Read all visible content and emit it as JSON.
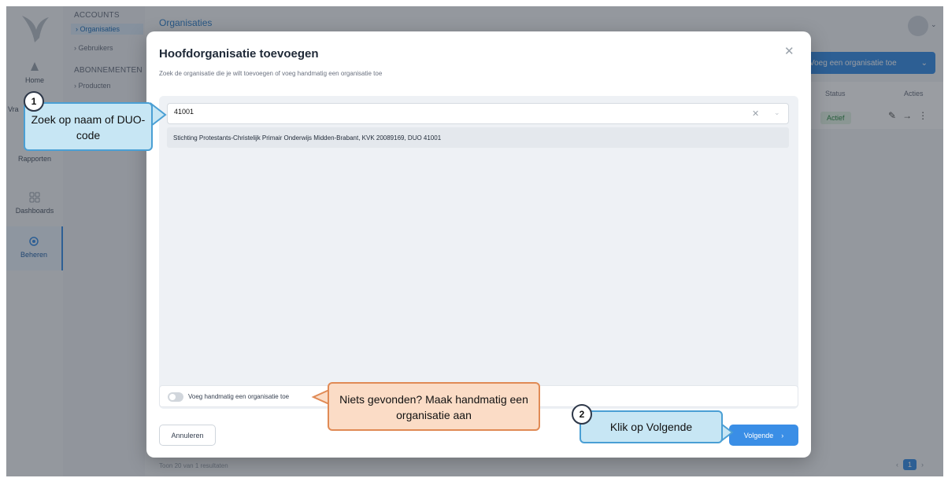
{
  "sidebar": {
    "items": [
      {
        "label": "Home",
        "icon": "home-icon"
      },
      {
        "label": "Vra",
        "icon": "question-icon"
      },
      {
        "label": "Rapporten",
        "icon": "report-icon"
      },
      {
        "label": "Dashboards",
        "icon": "dashboard-icon"
      },
      {
        "label": "Beheren",
        "icon": "gear-icon",
        "active": true
      }
    ]
  },
  "subnav": {
    "accounts_heading": "ACCOUNTS",
    "organisaties": "Organisaties",
    "gebruikers": "Gebruikers",
    "abonnementen_heading": "ABONNEMENTEN",
    "producten": "Producten"
  },
  "page": {
    "title": "Organisaties",
    "add_button": "Voeg een organisatie toe",
    "columns": [
      "Status",
      "Acties"
    ],
    "status_value": "Actief",
    "footer_prefix": "Toon",
    "footer_count": "20",
    "footer_suffix": "van 1 resultaten",
    "current_page": "1"
  },
  "modal": {
    "title": "Hoofdorganisatie toevoegen",
    "subtitle": "Zoek de organisatie die je wilt toevoegen of voeg handmatig een organisatie toe",
    "search_value": "41001",
    "result": "Stichting Protestants-Christelijk Primair Onderwijs Midden-Brabant, KVK 20089169, DUO 41001",
    "toggle_label": "Voeg handmatig een organisatie toe",
    "cancel_label": "Annuleren",
    "next_label": "Volgende"
  },
  "callouts": {
    "step1_number": "1",
    "step1_text": "Zoek op naam of DUO-code",
    "step2_number": "2",
    "step2_text": "Klik op Volgende",
    "hint_text": "Niets gevonden? Maak handmatig een organisatie aan"
  },
  "colors": {
    "accent": "#3a8ee6",
    "callout_blue": "#c7e6f4",
    "callout_orange": "#fbdcc6"
  }
}
